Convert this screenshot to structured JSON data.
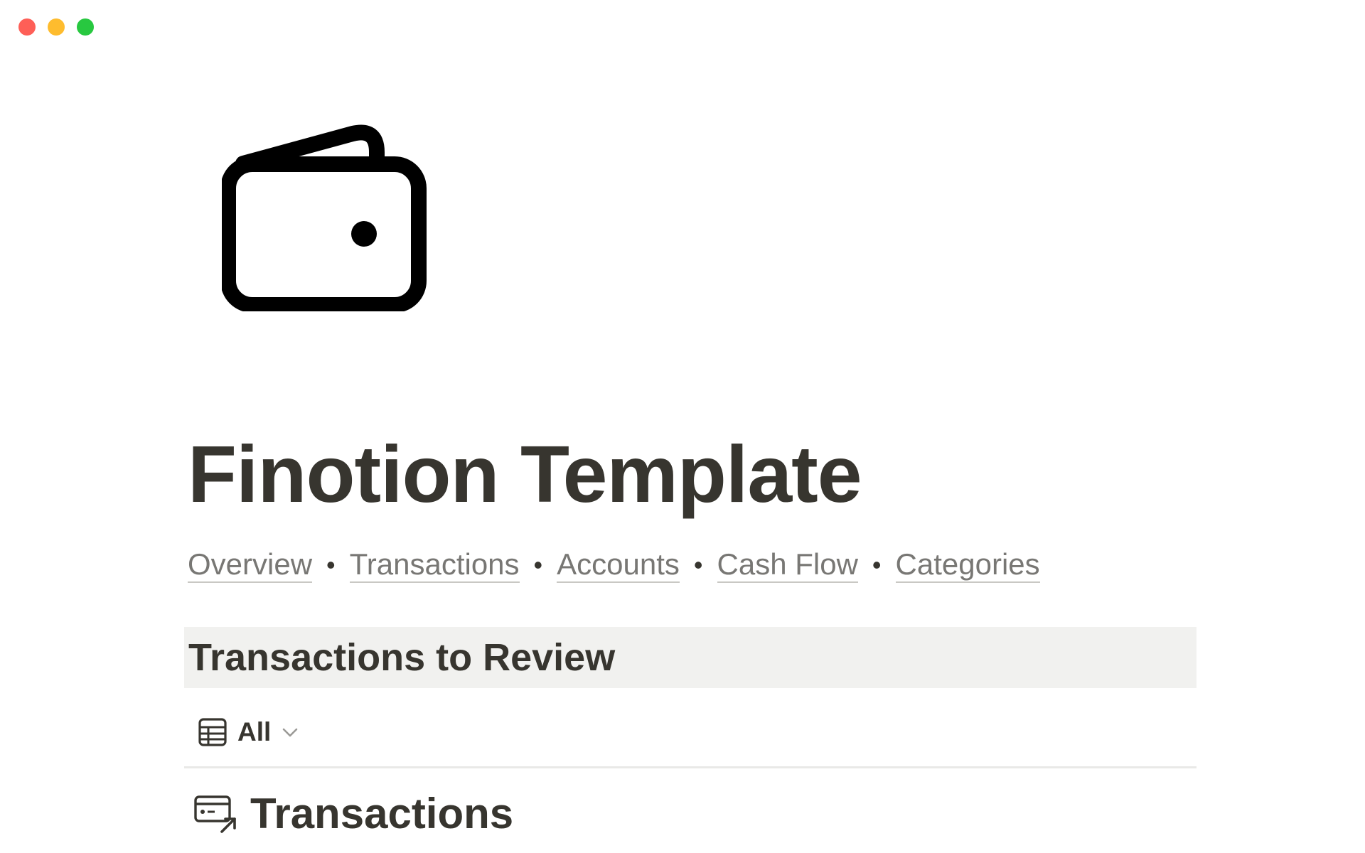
{
  "window": {
    "traffic_lights": [
      "close",
      "minimize",
      "zoom"
    ],
    "colors": {
      "close": "#fe5f57",
      "minimize": "#febc2e",
      "zoom": "#28c840"
    }
  },
  "page": {
    "icon": "wallet-icon",
    "title": "Finotion Template",
    "nav_links": [
      {
        "label": "Overview"
      },
      {
        "label": "Transactions"
      },
      {
        "label": "Accounts"
      },
      {
        "label": "Cash Flow"
      },
      {
        "label": "Categories"
      }
    ],
    "nav_separator": "•"
  },
  "section": {
    "heading": "Transactions to Review",
    "view_tab": {
      "icon": "table-icon",
      "label": "All",
      "dropdown_icon": "chevron-down-icon"
    },
    "database": {
      "icon": "linked-database-icon",
      "title": "Transactions"
    }
  },
  "colors": {
    "text": "#37352f",
    "muted_text": "#787774",
    "header_background": "#f1f1ef",
    "divider": "#e9e9e7"
  }
}
